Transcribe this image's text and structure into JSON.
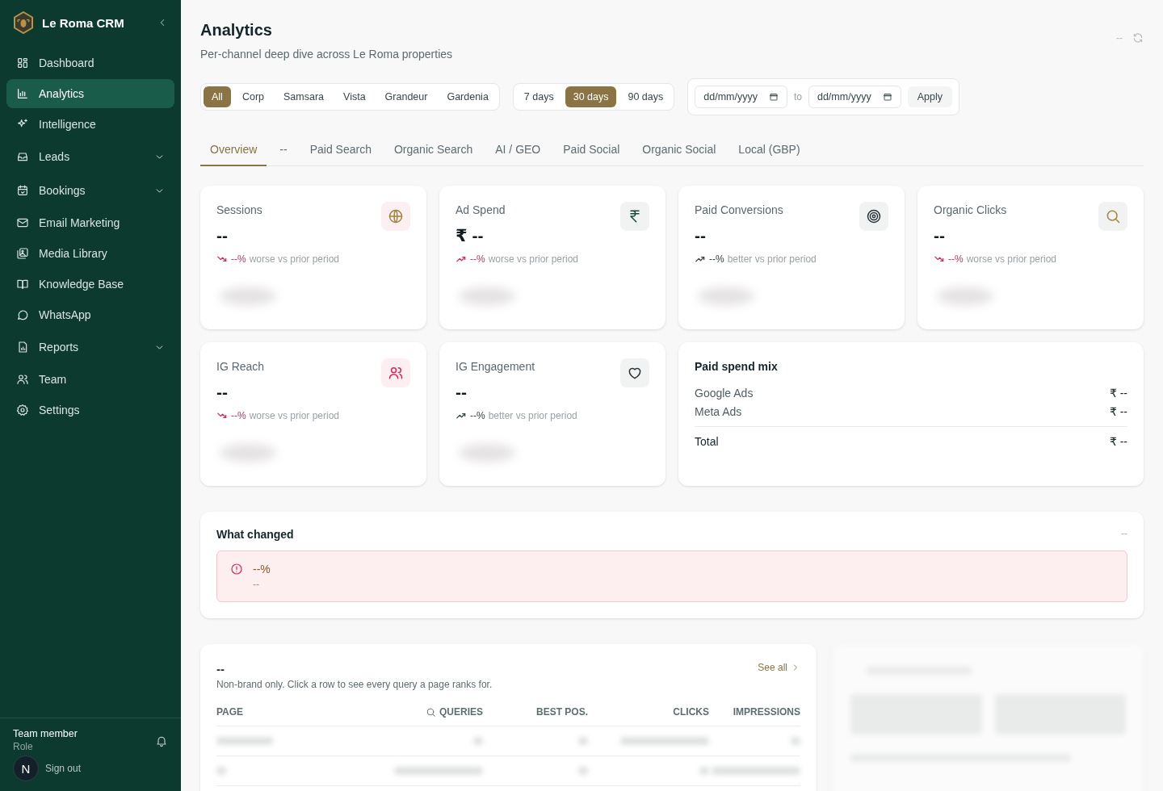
{
  "sidebar": {
    "brand": "Le Roma CRM",
    "items": [
      {
        "label": "Dashboard",
        "selected": false,
        "expandable": false
      },
      {
        "label": "Analytics",
        "selected": true,
        "expandable": false
      },
      {
        "label": "Intelligence",
        "selected": false,
        "expandable": false
      },
      {
        "label": "Leads",
        "selected": false,
        "expandable": true
      },
      {
        "label": "Bookings",
        "selected": false,
        "expandable": true
      },
      {
        "label": "Email Marketing",
        "selected": false,
        "expandable": false
      },
      {
        "label": "Media Library",
        "selected": false,
        "expandable": false
      },
      {
        "label": "Knowledge Base",
        "selected": false,
        "expandable": false
      },
      {
        "label": "WhatsApp",
        "selected": false,
        "expandable": false
      },
      {
        "label": "Reports",
        "selected": false,
        "expandable": true
      },
      {
        "label": "Team",
        "selected": false,
        "expandable": false
      },
      {
        "label": "Settings",
        "selected": false,
        "expandable": false
      }
    ],
    "user": {
      "name": "Team member",
      "role": "Role",
      "avatar": "N",
      "sign_out": "Sign out"
    }
  },
  "header": {
    "title": "Analytics",
    "subtitle": "Per-channel deep dive across Le Roma properties",
    "status": "--"
  },
  "properties": [
    {
      "label": "All",
      "selected": true
    },
    {
      "label": "Corp",
      "selected": false
    },
    {
      "label": "Samsara",
      "selected": false
    },
    {
      "label": "Vista",
      "selected": false
    },
    {
      "label": "Grandeur",
      "selected": false
    },
    {
      "label": "Gardenia",
      "selected": false
    }
  ],
  "ranges": [
    {
      "label": "7 days",
      "selected": false
    },
    {
      "label": "30 days",
      "selected": true
    },
    {
      "label": "90 days",
      "selected": false
    }
  ],
  "date_range": {
    "from_placeholder": "dd/mm/yyyy",
    "to_label": "to",
    "to_placeholder": "dd/mm/yyyy",
    "apply": "Apply"
  },
  "tabs": [
    {
      "label": "Overview",
      "selected": true
    },
    {
      "label": "--",
      "selected": false
    },
    {
      "label": "Paid Search",
      "selected": false
    },
    {
      "label": "Organic Search",
      "selected": false
    },
    {
      "label": "AI / GEO",
      "selected": false
    },
    {
      "label": "Paid Social",
      "selected": false
    },
    {
      "label": "Organic Social",
      "selected": false
    },
    {
      "label": "Local (GBP)",
      "selected": false
    }
  ],
  "metrics": [
    {
      "label": "Sessions",
      "value": "--",
      "rising": false,
      "negative": true,
      "delta": "--%",
      "note": "worse vs prior period"
    },
    {
      "label": "Ad Spend",
      "value": "₹ --",
      "rising": true,
      "negative": true,
      "delta": "--%",
      "note": "worse vs prior period"
    },
    {
      "label": "Paid Conversions",
      "value": "--",
      "rising": true,
      "negative": false,
      "delta": "--%",
      "note": "better vs prior period"
    },
    {
      "label": "Organic Clicks",
      "value": "--",
      "rising": false,
      "negative": true,
      "delta": "--%",
      "note": "worse vs prior period"
    },
    {
      "label": "IG Reach",
      "value": "--",
      "rising": false,
      "negative": true,
      "delta": "--%",
      "note": "worse vs prior period"
    },
    {
      "label": "IG Engagement",
      "value": "--",
      "rising": true,
      "negative": false,
      "delta": "--%",
      "note": "better vs prior period"
    }
  ],
  "spend_mix": {
    "title": "Paid spend mix",
    "rows": [
      {
        "label": "Google Ads",
        "value": "₹ --"
      },
      {
        "label": "Meta Ads",
        "value": "₹ --"
      }
    ],
    "total": {
      "label": "Total",
      "value": "₹ --"
    }
  },
  "what_changed": {
    "title": "What changed",
    "status": "--",
    "alert": {
      "headline": "--%",
      "detail": "--"
    }
  },
  "pages_table": {
    "title": "--",
    "see_all": "See all",
    "note": "Non-brand only. Click a row to see every query a page ranks for.",
    "columns": [
      "PAGE",
      "QUERIES",
      "BEST POS.",
      "CLICKS",
      "IMPRESSIONS"
    ]
  }
}
